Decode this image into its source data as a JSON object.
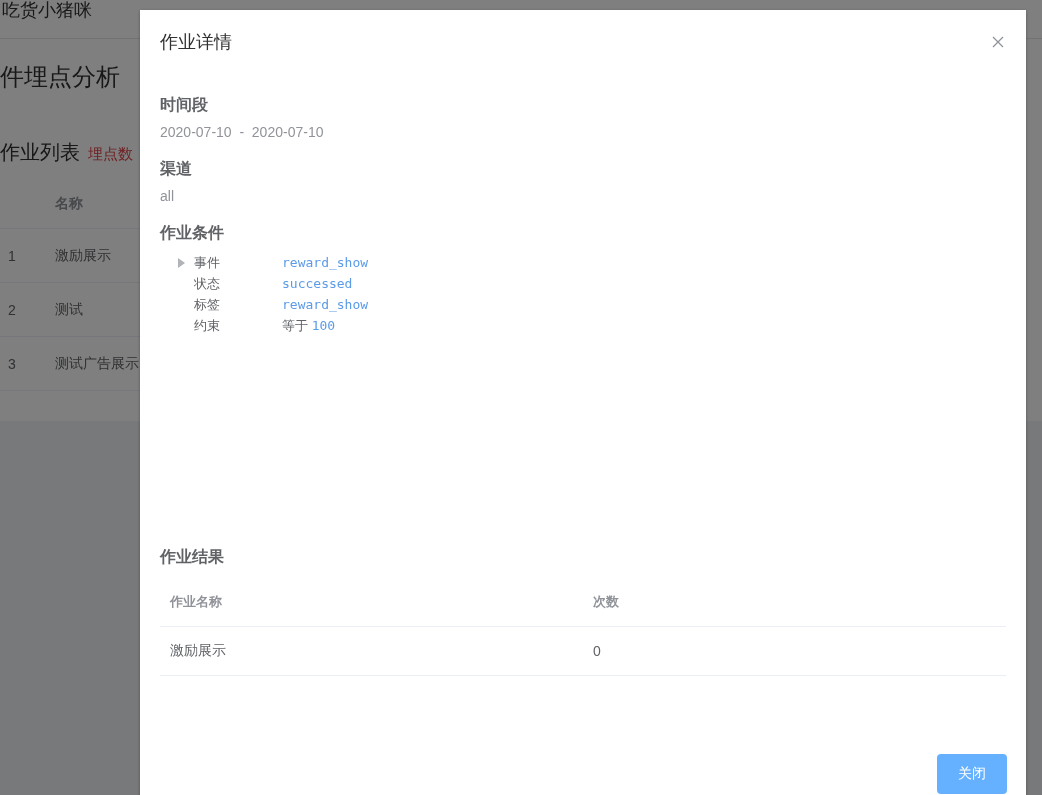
{
  "page": {
    "breadcrumb": [
      "吃货小猪咪"
    ],
    "heading": "件埋点分析",
    "section_title": "作业列表",
    "section_link": "埋点数",
    "table": {
      "columns": [
        "",
        "名称"
      ],
      "rows": [
        [
          "1",
          "激励展示"
        ],
        [
          "2",
          "测试"
        ],
        [
          "3",
          "测试广告展示"
        ]
      ]
    }
  },
  "dialog": {
    "title": "作业详情",
    "sections": [
      {
        "kind": "text",
        "title": "时间段",
        "value": "2020-07-10  -  2020-07-10"
      },
      {
        "kind": "text",
        "title": "渠道",
        "value": "all"
      },
      {
        "kind": "conditions",
        "title": "作业条件",
        "items": [
          {
            "label": "事件",
            "value": "reward_show",
            "toggle": true
          },
          {
            "label": "状态",
            "value": "successed",
            "toggle": false
          },
          {
            "label": "标签",
            "value": "reward_show",
            "toggle": false
          },
          {
            "label": "约束",
            "prefix": "等于",
            "value": "100",
            "toggle": false
          }
        ]
      },
      {
        "kind": "table",
        "title": "作业结果",
        "columns": [
          "作业名称",
          "次数"
        ],
        "rows": [
          [
            "激励展示",
            "0"
          ]
        ]
      }
    ],
    "buttons": [
      "关闭"
    ]
  }
}
